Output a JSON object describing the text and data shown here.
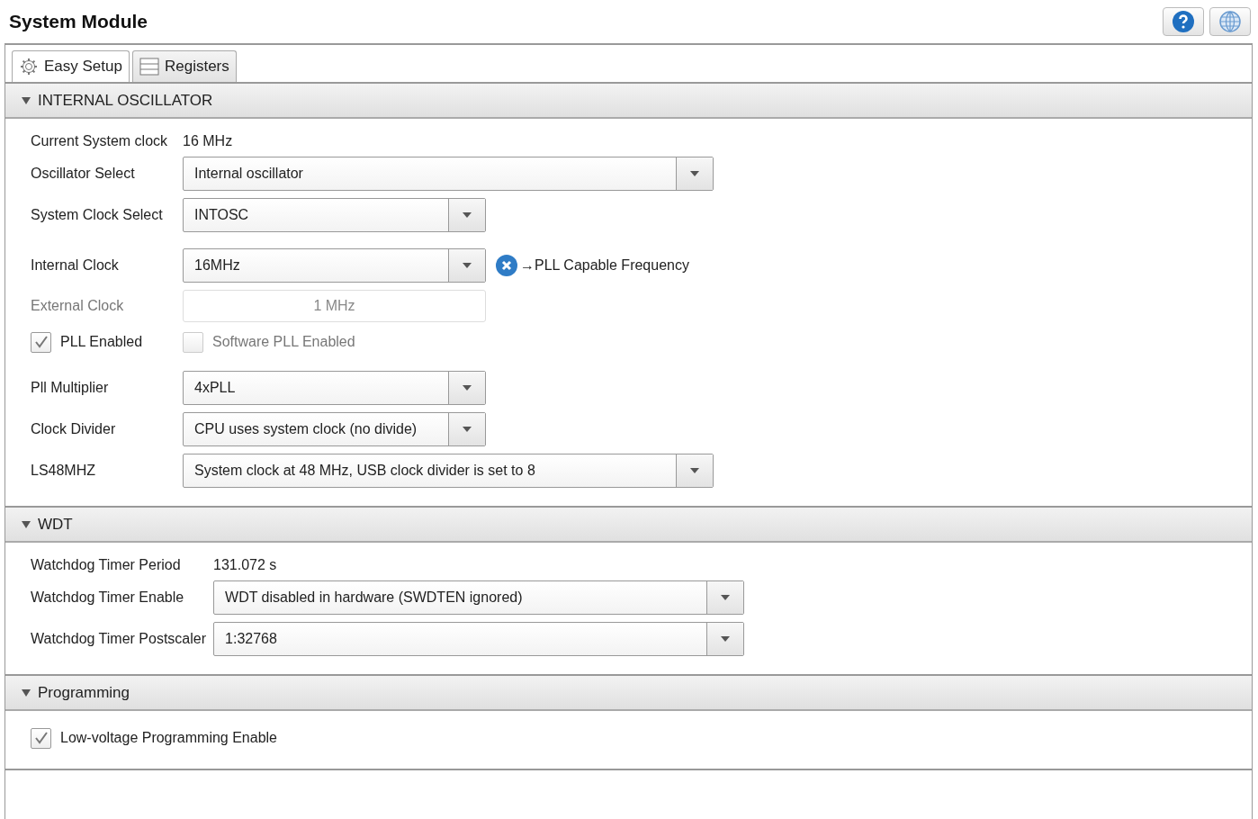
{
  "title": "System Module",
  "tabs": [
    {
      "label": "Easy Setup",
      "selected": true
    },
    {
      "label": "Registers",
      "selected": false
    }
  ],
  "sections": [
    {
      "title": "INTERNAL OSCILLATOR",
      "expanded": true,
      "groups": [
        [
          {
            "kind": "reading",
            "label": "Current System clock",
            "value": "16 MHz"
          },
          {
            "kind": "select",
            "label": "Oscillator Select",
            "value": "Internal oscillator",
            "wide": true
          },
          {
            "kind": "select",
            "label": "System Clock Select",
            "value": "INTOSC",
            "wide": false
          }
        ],
        [
          {
            "kind": "select",
            "label": "Internal Clock",
            "value": "16MHz",
            "wide": false,
            "note": "→PLL Capable Frequency"
          },
          {
            "kind": "field",
            "label": "External Clock",
            "value": "1 MHz",
            "disabled": true
          },
          {
            "kind": "checks",
            "items": [
              {
                "label": "PLL Enabled",
                "checked": true,
                "disabled": false
              },
              {
                "label": "Software PLL Enabled",
                "checked": false,
                "disabled": true
              }
            ]
          }
        ],
        [
          {
            "kind": "select",
            "label": "Pll Multiplier",
            "value": "4xPLL",
            "wide": false
          },
          {
            "kind": "select",
            "label": "Clock Divider",
            "value": "CPU uses system clock (no divide)",
            "wide": false
          },
          {
            "kind": "select",
            "label": "LS48MHZ",
            "value": "System clock at 48 MHz, USB clock divider is set to 8",
            "wide": true
          }
        ]
      ]
    },
    {
      "title": "WDT",
      "expanded": true,
      "groups": [
        [
          {
            "kind": "reading",
            "label": "Watchdog Timer Period",
            "value": "131.072 s"
          },
          {
            "kind": "select",
            "label": "Watchdog Timer Enable",
            "value": "WDT disabled in hardware (SWDTEN ignored)",
            "wide": true
          },
          {
            "kind": "select",
            "label": "Watchdog Timer Postscaler",
            "value": "1:32768",
            "wide": true
          }
        ]
      ]
    },
    {
      "title": "Programming",
      "expanded": true,
      "groups": [
        [
          {
            "kind": "checks",
            "items": [
              {
                "label": "Low-voltage Programming Enable",
                "checked": true,
                "disabled": false
              }
            ]
          }
        ]
      ]
    }
  ]
}
